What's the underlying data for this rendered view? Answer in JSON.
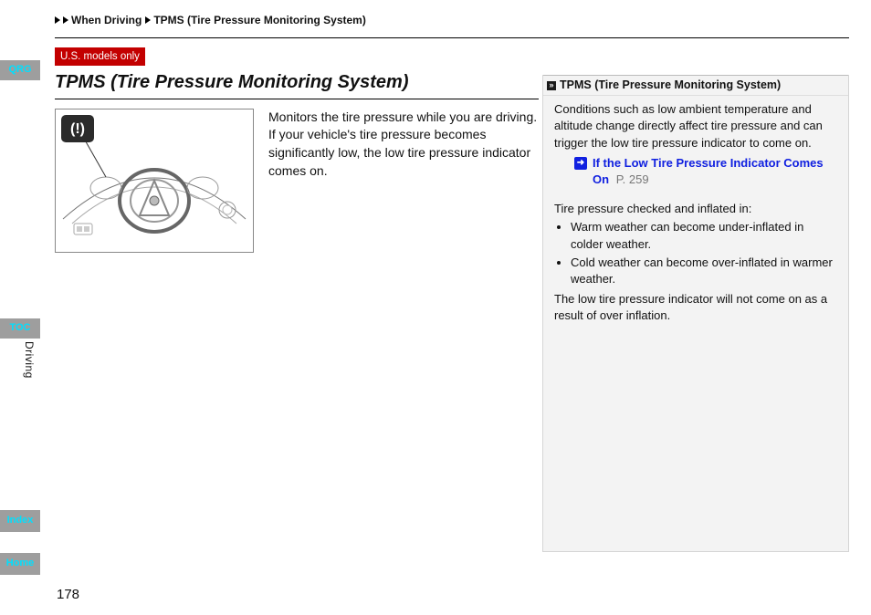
{
  "nav_tabs": {
    "qrg": "QRG",
    "toc": "TOC",
    "index": "Index",
    "home": "Home"
  },
  "side_section": "Driving",
  "page_number": "178",
  "breadcrumb": {
    "level1": "",
    "level2": "When Driving",
    "level3": "TPMS (Tire Pressure Monitoring System)"
  },
  "badge": "U.S. models only",
  "title": "TPMS (Tire Pressure Monitoring System)",
  "intro": "Monitors the tire pressure while you are driving. If your vehicle's tire pressure becomes significantly low, the low tire pressure indicator comes on.",
  "figure_alt": "Dashboard illustration with low-tire-pressure indicator callout",
  "sidebar": {
    "header": "TPMS (Tire Pressure Monitoring System)",
    "para1": "Conditions such as low ambient temperature and altitude change directly affect tire pressure and can trigger the low tire pressure indicator to come on.",
    "xref_label": "If the Low Tire Pressure Indicator Comes On",
    "xref_page": "P. 259",
    "para2": "Tire pressure checked and inflated in:",
    "bullets": [
      "Warm weather can become under-inflated in colder weather.",
      "Cold weather can become over-inflated in warmer weather."
    ],
    "para3": "The low tire pressure indicator will not come on as a result of over inflation."
  }
}
